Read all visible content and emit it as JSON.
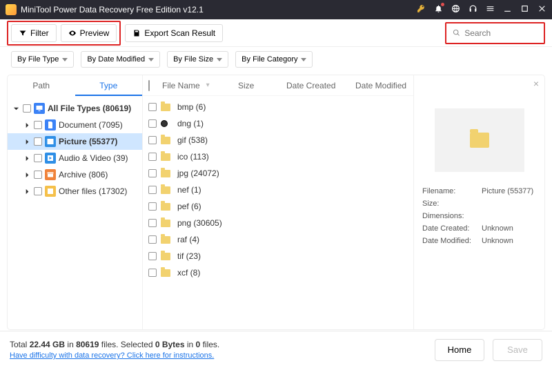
{
  "window": {
    "title": "MiniTool Power Data Recovery Free Edition v12.1"
  },
  "toolbar": {
    "filter": "Filter",
    "preview": "Preview",
    "export": "Export Scan Result"
  },
  "search": {
    "placeholder": "Search"
  },
  "filters": {
    "by_type": "By File Type",
    "by_date": "By Date Modified",
    "by_size": "By File Size",
    "by_category": "By File Category"
  },
  "side_tabs": {
    "path": "Path",
    "type": "Type"
  },
  "tree": {
    "all": "All File Types (80619)",
    "doc": "Document (7095)",
    "pic": "Picture (55377)",
    "av": "Audio & Video (39)",
    "arch": "Archive (806)",
    "other": "Other files (17302)"
  },
  "columns": {
    "name": "File Name",
    "size": "Size",
    "dc": "Date Created",
    "dm": "Date Modified"
  },
  "files": {
    "r0": "bmp (6)",
    "r1": "dng (1)",
    "r2": "gif (538)",
    "r3": "ico (113)",
    "r4": "jpg (24072)",
    "r5": "nef (1)",
    "r6": "pef (6)",
    "r7": "png (30605)",
    "r8": "raf (4)",
    "r9": "tif (23)",
    "r10": "xcf (8)"
  },
  "preview": {
    "filename_k": "Filename:",
    "filename_v": "Picture (55377)",
    "size_k": "Size:",
    "dim_k": "Dimensions:",
    "dc_k": "Date Created:",
    "dc_v": "Unknown",
    "dm_k": "Date Modified:",
    "dm_v": "Unknown"
  },
  "footer": {
    "line1_a": "Total ",
    "line1_b": "22.44 GB",
    "line1_c": " in ",
    "line1_d": "80619",
    "line1_e": " files.   Selected ",
    "line1_f": "0 Bytes",
    "line1_g": " in ",
    "line1_h": "0",
    "line1_i": " files.",
    "link": "Have difficulty with data recovery? Click here for instructions.",
    "home": "Home",
    "save": "Save"
  }
}
